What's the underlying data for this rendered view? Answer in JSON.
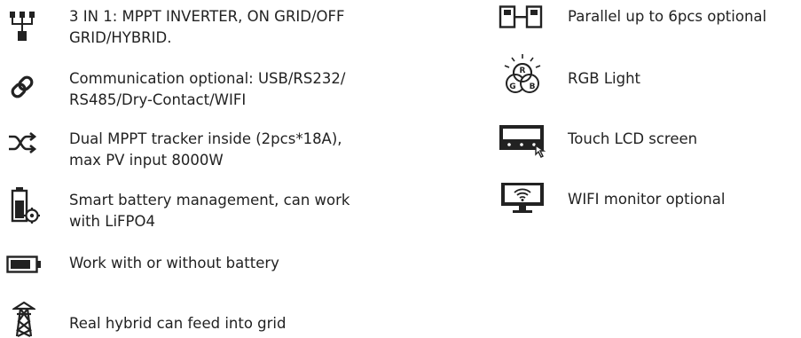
{
  "features_left": [
    {
      "icon": "network-tree-icon",
      "lines": [
        "3 IN 1: MPPT INVERTER, ON GRID/OFF",
        "GRID/HYBRID."
      ]
    },
    {
      "icon": "link-icon",
      "lines": [
        "Communication optional: USB/RS232/",
        "RS485/Dry-Contact/WIFI"
      ]
    },
    {
      "icon": "shuffle-arrows-icon",
      "lines": [
        "Dual MPPT tracker inside (2pcs*18A),",
        "max PV input 8000W"
      ]
    },
    {
      "icon": "battery-gear-icon",
      "lines": [
        "Smart battery management, can work",
        "with LiFPO4"
      ]
    },
    {
      "icon": "battery-icon",
      "lines": [
        "Work with or without battery"
      ]
    },
    {
      "icon": "power-tower-icon",
      "lines": [
        "Real hybrid can feed into grid"
      ]
    }
  ],
  "features_right": [
    {
      "icon": "parallel-units-icon",
      "lines": [
        "Parallel up to 6pcs optional"
      ]
    },
    {
      "icon": "rgb-light-icon",
      "lines": [
        "RGB Light"
      ],
      "rgb_letters": [
        "R",
        "G",
        "B"
      ]
    },
    {
      "icon": "touch-screen-icon",
      "lines": [
        "Touch LCD screen"
      ]
    },
    {
      "icon": "wifi-monitor-icon",
      "lines": [
        "WIFI monitor optional"
      ]
    }
  ]
}
